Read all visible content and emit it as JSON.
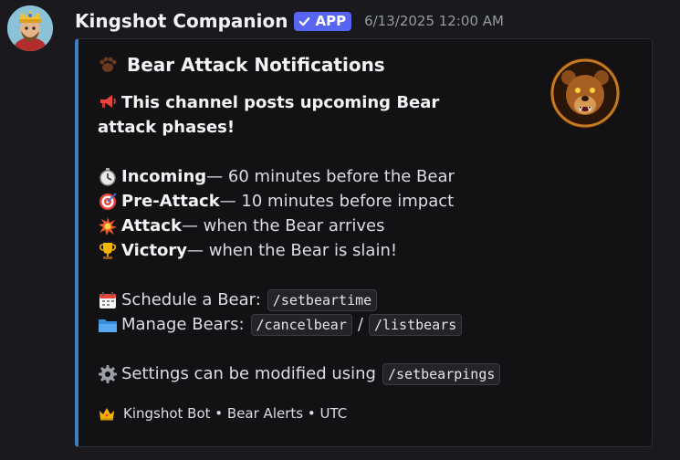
{
  "message": {
    "author": "Kingshot Companion",
    "badge": "APP",
    "timestamp": "6/13/2025 12:00 AM"
  },
  "embed": {
    "title": "Bear Attack Notifications",
    "title_icon": "bear-paw-icon",
    "accent_color": "#3b82c4",
    "intro": "This channel posts upcoming Bear attack phases!",
    "intro_icon": "megaphone-icon",
    "phases": [
      {
        "icon": "stopwatch-icon",
        "name": "Incoming",
        "text": " — 60 minutes before the Bear"
      },
      {
        "icon": "target-icon",
        "name": "Pre-Attack",
        "text": " — 10 minutes before impact"
      },
      {
        "icon": "explosion-icon",
        "name": "Attack",
        "text": " — when the Bear arrives"
      },
      {
        "icon": "trophy-icon",
        "name": "Victory",
        "text": " — when the Bear is slain!"
      }
    ],
    "schedule": {
      "icon": "calendar-icon",
      "label": "Schedule a Bear:",
      "command": "/setbeartime"
    },
    "manage": {
      "icon": "folder-icon",
      "label": "Manage Bears:",
      "command1": "/cancelbear",
      "separator": "/",
      "command2": "/listbears"
    },
    "settings": {
      "icon": "gear-icon",
      "label": "Settings can be modified using",
      "command": "/setbearpings"
    },
    "footer": {
      "icon": "crown-icon",
      "text": "Kingshot Bot • Bear Alerts • UTC"
    }
  }
}
